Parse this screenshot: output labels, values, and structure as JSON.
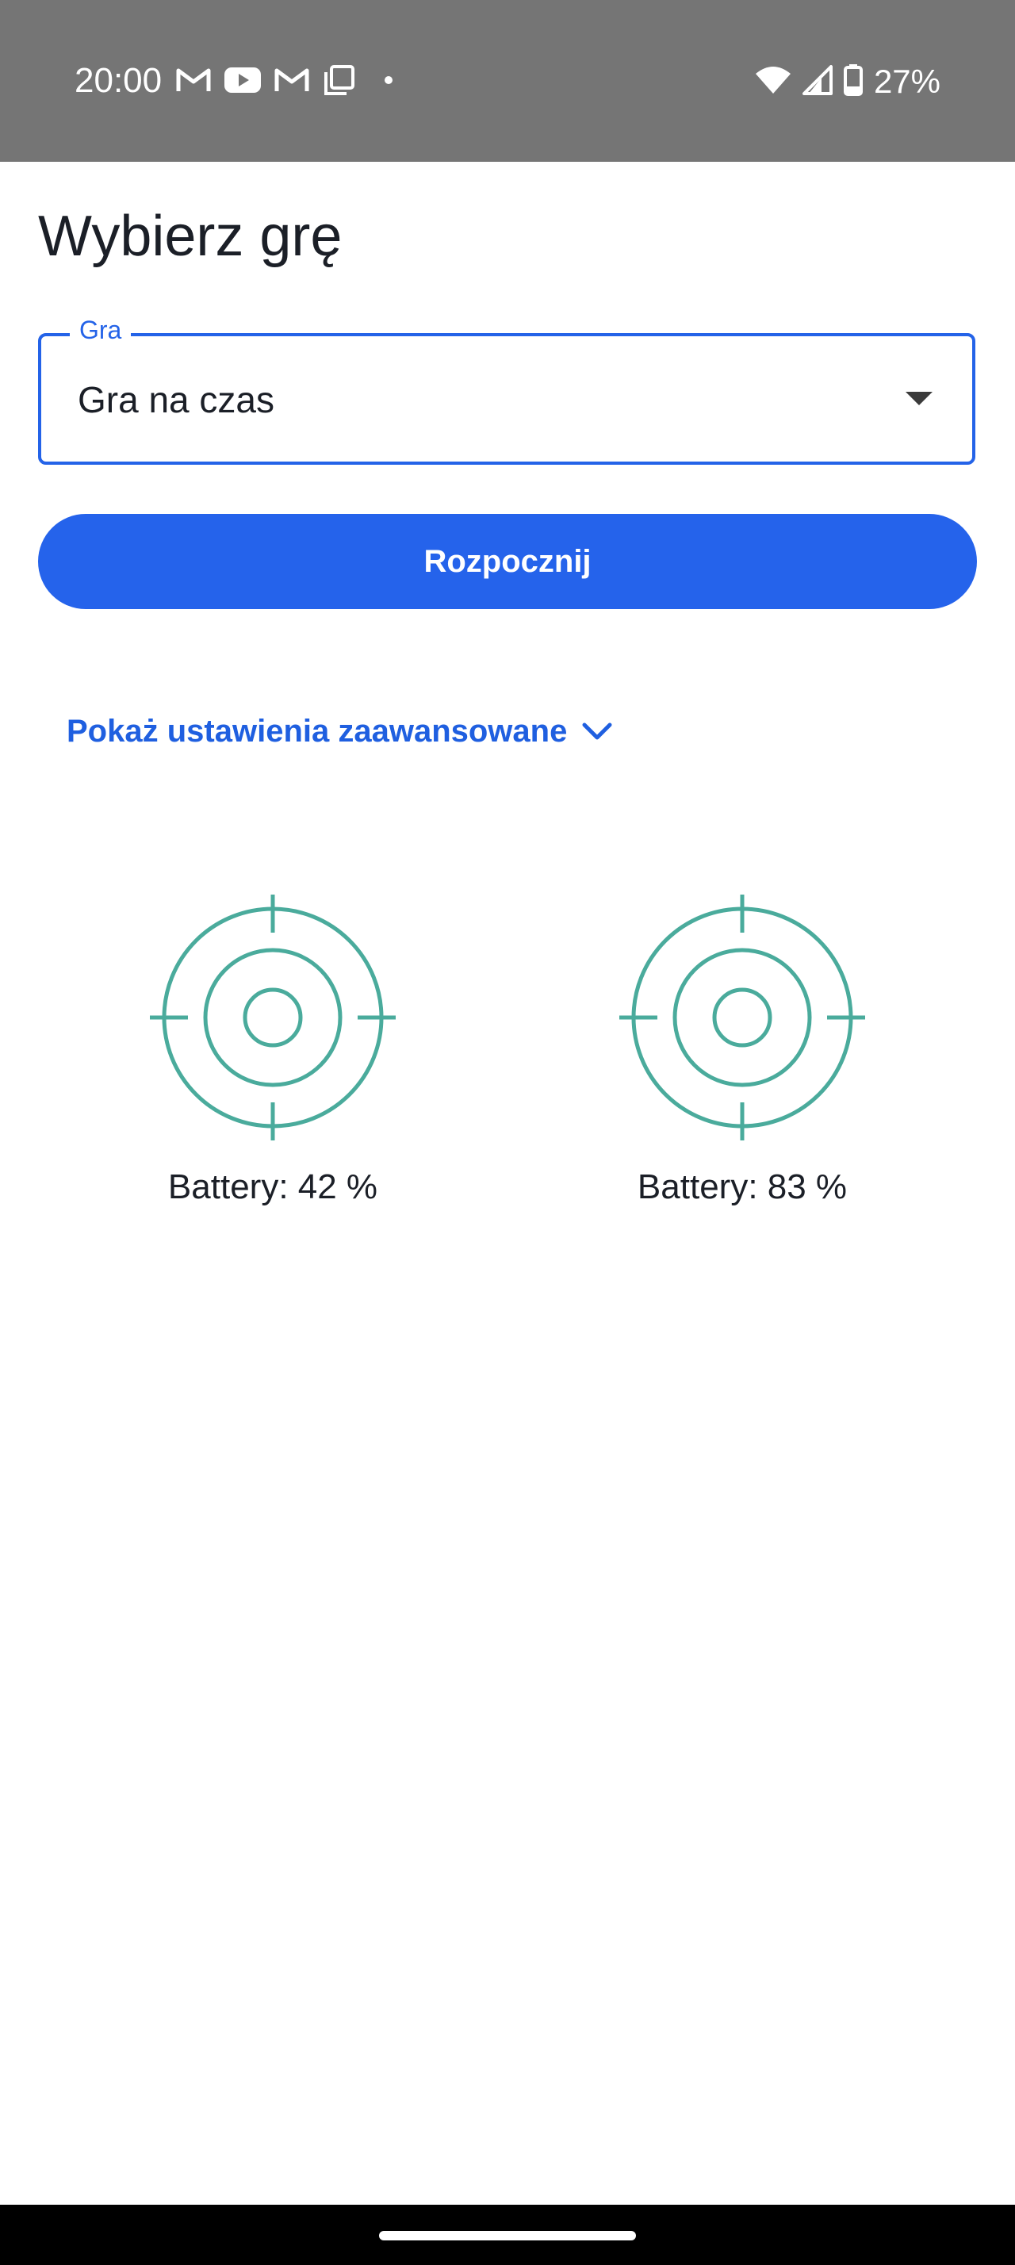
{
  "status_bar": {
    "time": "20:00",
    "notification_icons": [
      "gmail-icon",
      "youtube-icon",
      "gmail-icon",
      "copy-icon",
      "dot-icon"
    ],
    "system_icons": [
      "wifi-icon",
      "cellular-signal-icon",
      "battery-icon"
    ],
    "battery_percent": "27%"
  },
  "page": {
    "title": "Wybierz grę"
  },
  "game_select": {
    "label": "Gra",
    "value": "Gra na czas"
  },
  "start_button": {
    "label": "Rozpocznij"
  },
  "advanced_toggle": {
    "label": "Pokaż ustawienia zaawansowane"
  },
  "devices": [
    {
      "icon": "target-icon",
      "battery_label": "Battery: 42 %"
    },
    {
      "icon": "target-icon",
      "battery_label": "Battery: 83 %"
    }
  ],
  "colors": {
    "accent": "#2563eb",
    "target": "#4aab9c",
    "status_bar": "#757575"
  }
}
